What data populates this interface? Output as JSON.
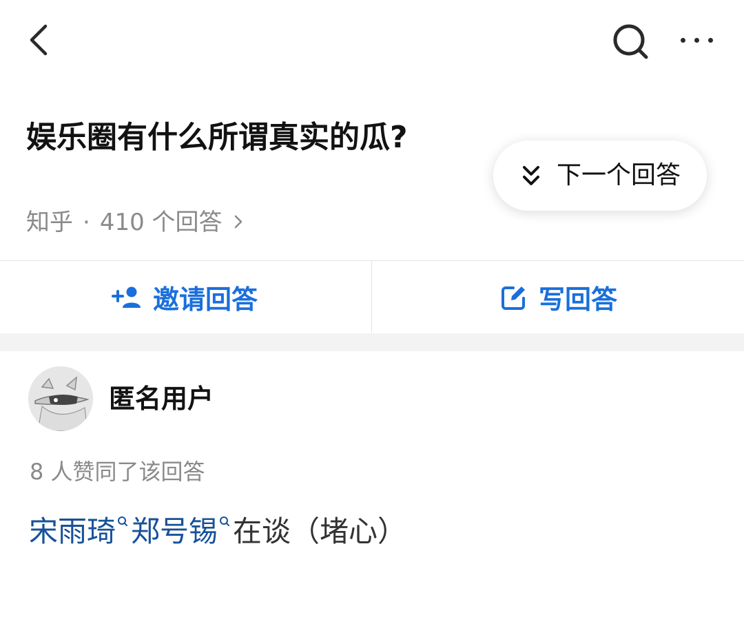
{
  "question": {
    "title": "娱乐圈有什么所谓真实的瓜?",
    "source": "知乎",
    "separator": "·",
    "answer_count": "410 个回答"
  },
  "next_answer": {
    "label": "下一个回答"
  },
  "actions": {
    "invite_label": "邀请回答",
    "write_label": "写回答"
  },
  "answer": {
    "author": "匿名用户",
    "votes": "8 人赞同了该回答",
    "content": {
      "link1": "宋雨琦",
      "link2": "郑号锡",
      "text": "在谈（堵心）"
    }
  },
  "colors": {
    "accent": "#1a6fdb",
    "link": "#175199",
    "muted": "#8a8a8a",
    "divider": "#e2e2e2",
    "section_gap": "#f3f3f3"
  },
  "icons": {
    "back": "back-arrow-icon",
    "search": "search-icon",
    "more": "more-icon",
    "next": "double-chevron-down-icon",
    "invite": "add-person-icon",
    "write": "edit-icon",
    "inline_search": "search-icon"
  }
}
